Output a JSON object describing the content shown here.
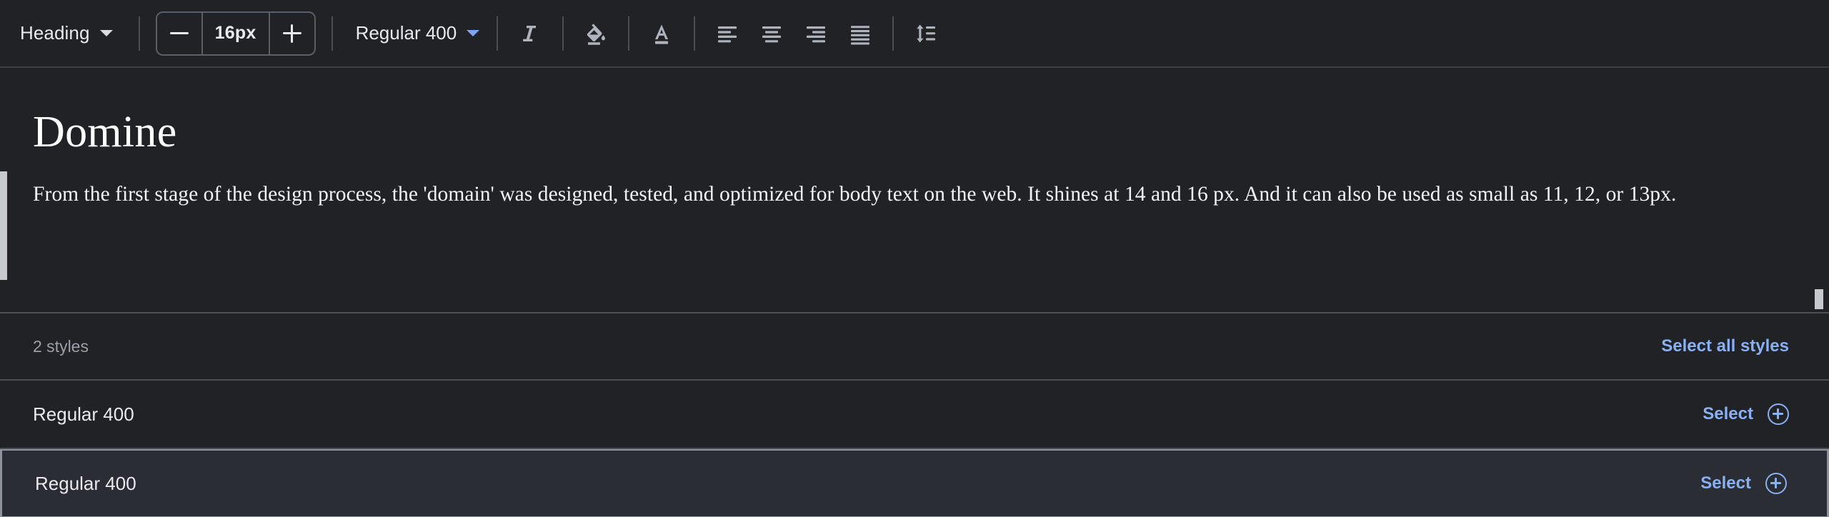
{
  "toolbar": {
    "block_style": {
      "label": "Heading",
      "caret_icon": "chevron-down-icon"
    },
    "font_size": {
      "decrease_label": "−",
      "value": "16px",
      "increase_label": "+"
    },
    "font_weight": {
      "label": "Regular 400",
      "caret_icon": "chevron-down-icon"
    },
    "icons": [
      {
        "name": "italic-icon",
        "title": "Italic"
      },
      {
        "name": "fill-color-icon",
        "title": "Highlight color"
      },
      {
        "name": "text-color-icon",
        "title": "Text color"
      },
      {
        "name": "align-left-icon",
        "title": "Align left"
      },
      {
        "name": "align-center-icon",
        "title": "Align center"
      },
      {
        "name": "align-right-icon",
        "title": "Align right"
      },
      {
        "name": "align-justify-icon",
        "title": "Justify"
      },
      {
        "name": "line-height-icon",
        "title": "Line height"
      }
    ]
  },
  "editor": {
    "heading": "Domine",
    "body": "From the first stage of the design process, the 'domain' was designed, tested, and optimized for body text on the web. It shines at 14 and 16 px. And it can also be used as small as 11, 12, or 13px."
  },
  "styles_panel": {
    "count_label": "2 styles",
    "select_all_label": "Select all styles",
    "rows": [
      {
        "name": "Regular 400",
        "action_label": "Select",
        "action_icon": "plus-circle-icon",
        "focused": false
      },
      {
        "name": "Regular 400",
        "action_label": "Select",
        "action_icon": "plus-circle-icon",
        "focused": true
      }
    ]
  },
  "colors": {
    "background": "#202226",
    "panel_border": "#4a4e55",
    "link_blue": "#8ab0f2",
    "text_primary": "#e8eaed",
    "text_muted": "#9aa0a8",
    "icon_gray": "#aeb4bd",
    "accent_bar": "#c6cad0"
  }
}
